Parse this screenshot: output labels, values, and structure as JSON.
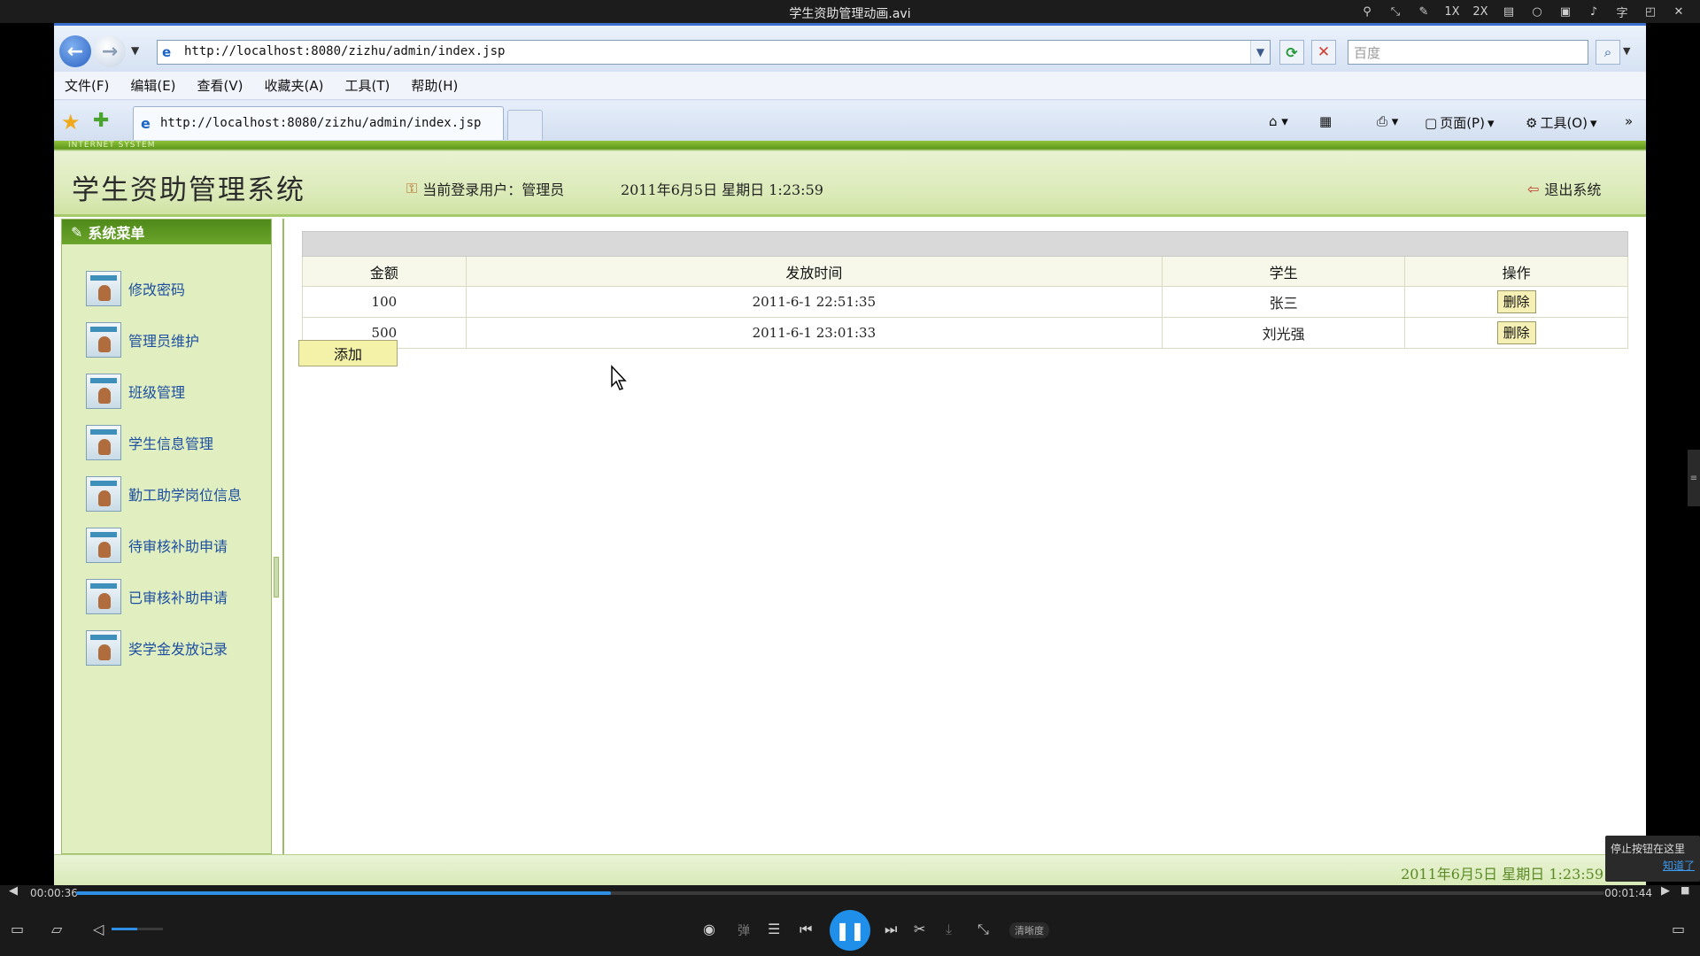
{
  "player": {
    "title": "学生资助管理动画.avi",
    "controls": [
      "1X",
      "2X"
    ],
    "current_time": "00:00:36",
    "total_time": "00:01:44",
    "progress": 0.35,
    "volume": 0.5,
    "quality_label": "清晰度",
    "danmu_label": "弹",
    "tip_text": "停止按钮在这里",
    "tip_link": "知道了"
  },
  "browser": {
    "url": "http://localhost:8080/zizhu/admin/index.jsp",
    "search_placeholder": "百度",
    "menu": [
      "文件(F)",
      "编辑(E)",
      "查看(V)",
      "收藏夹(A)",
      "工具(T)",
      "帮助(H)"
    ],
    "tab_title": "http://localhost:8080/zizhu/admin/index.jsp",
    "tools": {
      "page": "页面(P)",
      "tools": "工具(O)"
    }
  },
  "app": {
    "tagline": "INTERNET SYSTEM",
    "title": "学生资助管理系统",
    "current_user": "当前登录用户：管理员",
    "datetime": "2011年6月5日  星期日  1:23:59",
    "logout": "退出系统",
    "footer_datetime": "2011年6月5日  星期日  1:23:59"
  },
  "sidebar": {
    "header": "系统菜单",
    "items": [
      {
        "label": "修改密码"
      },
      {
        "label": "管理员维护"
      },
      {
        "label": "班级管理"
      },
      {
        "label": "学生信息管理"
      },
      {
        "label": "勤工助学岗位信息"
      },
      {
        "label": "待审核补助申请"
      },
      {
        "label": "已审核补助申请"
      },
      {
        "label": "奖学金发放记录"
      }
    ]
  },
  "table": {
    "columns": [
      "金额",
      "发放时间",
      "学生",
      "操作"
    ],
    "rows": [
      {
        "amount": "100",
        "time": "2011-6-1 22:51:35",
        "student": "张三",
        "action": "删除"
      },
      {
        "amount": "500",
        "time": "2011-6-1 23:01:33",
        "student": "刘光强",
        "action": "删除"
      }
    ],
    "add_label": "添加"
  },
  "colors": {
    "accent": "#5f9a1b",
    "sidebar_bg": "#e0eec0",
    "player_accent": "#1f8fea"
  }
}
